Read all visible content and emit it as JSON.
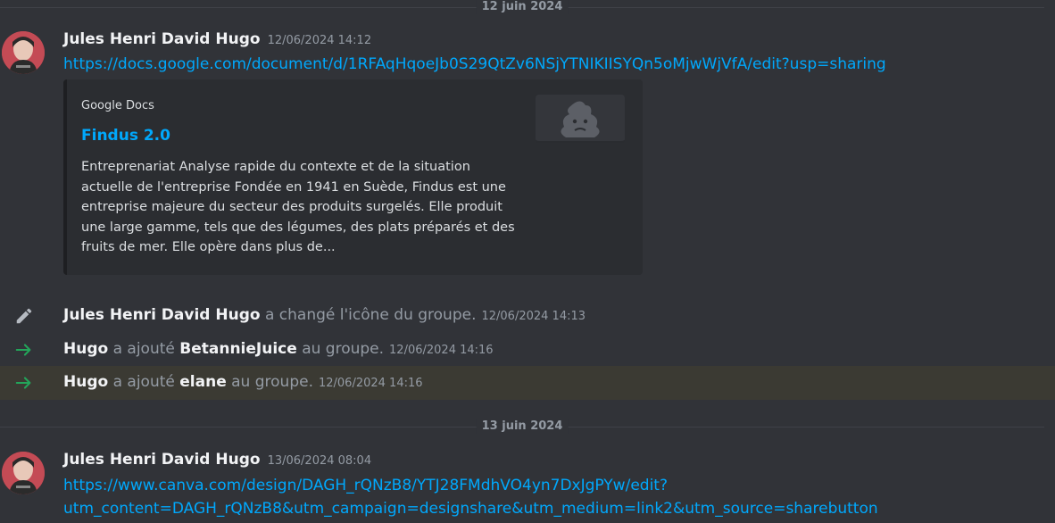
{
  "dividers": {
    "first": "12 juin 2024",
    "second": "13 juin 2024"
  },
  "messages": [
    {
      "author": "Jules Henri David Hugo",
      "timestamp": "12/06/2024 14:12",
      "link": "https://docs.google.com/document/d/1RFAqHqoeJb0S29QtZv6NSjYTNIKIISYQn5oMjwWjVfA/edit?usp=sharing",
      "embed": {
        "provider": "Google Docs",
        "title": "Findus 2.0",
        "description": "Entreprenariat Analyse rapide du contexte et de la situation actuelle de l'entreprise Fondée en 1941 en Suède, Findus est une entreprise majeure du secteur des produits surgelés. Elle produit une large gamme, tels que des légumes, des plats préparés et des fruits de mer. Elle opère dans plus de..."
      }
    },
    {
      "author": "Jules Henri David Hugo",
      "timestamp": "13/06/2024 08:04",
      "link_line1": "https://www.canva.com/design/DAGH_rQNzB8/YTJ28FMdhVO4yn7DxJgPYw/edit?",
      "link_line2": "utm_content=DAGH_rQNzB8&utm_campaign=designshare&utm_medium=link2&utm_source=sharebutton"
    }
  ],
  "system_events": [
    {
      "icon": "pencil-icon",
      "actor": "Jules Henri David Hugo",
      "action": "a changé l'icône du groupe.",
      "timestamp": "12/06/2024 14:13"
    },
    {
      "icon": "arrow-right-icon",
      "actor": "Hugo",
      "action_before": "a ajouté",
      "target": "BetannieJuice",
      "action_after": "au groupe.",
      "timestamp": "12/06/2024 14:16"
    },
    {
      "icon": "arrow-right-icon",
      "actor": "Hugo",
      "action_before": "a ajouté",
      "target": "elane",
      "action_after": "au groupe.",
      "timestamp": "12/06/2024 14:16",
      "highlighted": true
    }
  ],
  "colors": {
    "link": "#00a8fc",
    "join_arrow": "#23a55a",
    "highlight": "#3b3a33",
    "background": "#313338"
  }
}
